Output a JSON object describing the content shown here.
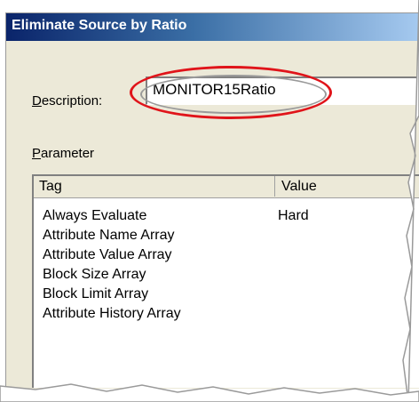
{
  "window": {
    "title": "Eliminate Source by Ratio"
  },
  "description": {
    "label_first": "D",
    "label_rest": "escription:",
    "value": "MONITOR15Ratio"
  },
  "parameter": {
    "label_first": "P",
    "label_rest": "arameter",
    "columns": [
      "Tag",
      "Value"
    ],
    "rows": [
      {
        "tag": "Always Evaluate",
        "value": "Hard"
      },
      {
        "tag": "Attribute Name Array",
        "value": ""
      },
      {
        "tag": "Attribute Value Array",
        "value": ""
      },
      {
        "tag": "Block Size Array",
        "value": ""
      },
      {
        "tag": "Block Limit Array",
        "value": ""
      },
      {
        "tag": "Attribute History Array",
        "value": ""
      }
    ]
  },
  "colors": {
    "highlight_ellipse": "#e0141a",
    "titlebar_start": "#0a246a",
    "dialog_bg": "#ece9d8"
  }
}
